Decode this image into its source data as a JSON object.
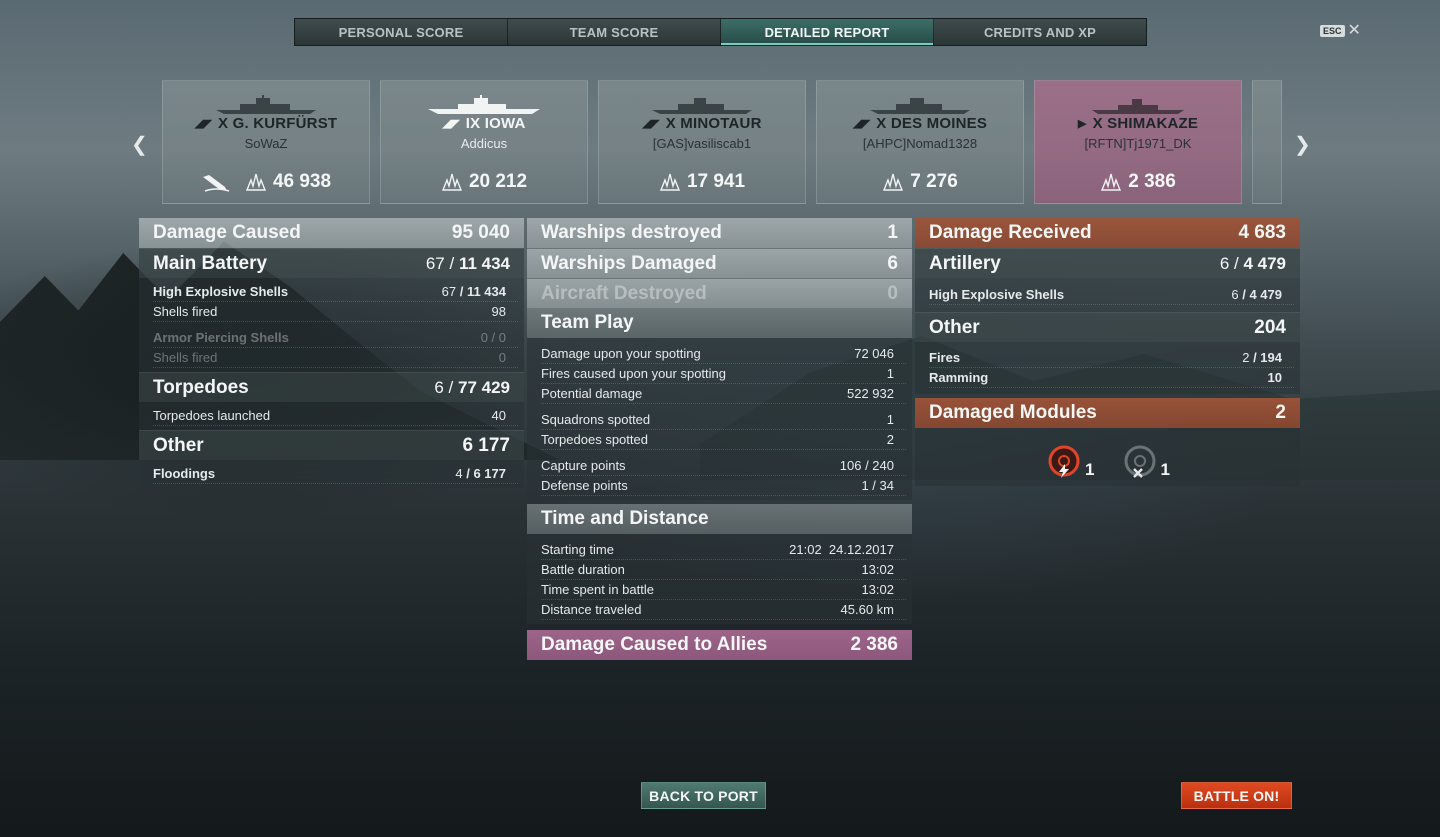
{
  "tabs": [
    "PERSONAL SCORE",
    "TEAM SCORE",
    "DETAILED REPORT",
    "CREDITS AND XP"
  ],
  "esc": {
    "key": "ESC",
    "close": "✕"
  },
  "nav": {
    "prev": "❮",
    "next": "❯"
  },
  "ships": [
    {
      "tier_name": "X G. KURFÜRST",
      "player": "SoWaZ",
      "damage": "46 938",
      "class_glyph": "◢◤",
      "sunk": true
    },
    {
      "tier_name": "IX IOWA",
      "player": "Addicus",
      "damage": "20 212",
      "class_glyph": "◢◤",
      "light": true
    },
    {
      "tier_name": "X MINOTAUR",
      "player": "[GAS]vasiliscab1",
      "damage": "17 941",
      "class_glyph": "◢◤"
    },
    {
      "tier_name": "X DES MOINES",
      "player": "[AHPC]Nomad1328",
      "damage": "7 276",
      "class_glyph": "◢◤"
    },
    {
      "tier_name": "X SHIMAKAZE",
      "player": "[RFTN]Tj1971_DK",
      "damage": "2 386",
      "class_glyph": "▶"
    }
  ],
  "damage_caused": {
    "title": "Damage Caused",
    "total": "95 040",
    "main_battery": {
      "title": "Main Battery",
      "hits": "67",
      "dmg": "11 434"
    },
    "he": {
      "label": "High Explosive Shells",
      "hits": "67",
      "dmg": "11 434"
    },
    "he_fired": {
      "label": "Shells fired",
      "value": "98"
    },
    "ap": {
      "label": "Armor Piercing Shells",
      "value": "0 / 0"
    },
    "ap_fired": {
      "label": "Shells fired",
      "value": "0"
    },
    "torpedoes": {
      "title": "Torpedoes",
      "hits": "6",
      "dmg": "77 429"
    },
    "torp_launched": {
      "label": "Torpedoes launched",
      "value": "40"
    },
    "other": {
      "title": "Other",
      "value": "6 177"
    },
    "floodings": {
      "label": "Floodings",
      "hits": "4",
      "dmg": "6 177"
    }
  },
  "middle": {
    "destroyed": {
      "label": "Warships destroyed",
      "value": "1"
    },
    "damaged": {
      "label": "Warships Damaged",
      "value": "6"
    },
    "aircraft": {
      "label": "Aircraft Destroyed",
      "value": "0"
    },
    "team_play": {
      "title": "Team Play",
      "rows": [
        {
          "label": "Damage upon your spotting",
          "value": "72 046"
        },
        {
          "label": "Fires caused upon your spotting",
          "value": "1"
        },
        {
          "label": "Potential damage",
          "value": "522 932"
        },
        {
          "label": "Squadrons spotted",
          "value": "1"
        },
        {
          "label": "Torpedoes spotted",
          "value": "2"
        },
        {
          "label": "Capture points",
          "value": "106 / 240"
        },
        {
          "label": "Defense points",
          "value": "1 / 34"
        }
      ]
    },
    "time": {
      "title": "Time and Distance",
      "rows": [
        {
          "label": "Starting time",
          "value": "21:02  24.12.2017"
        },
        {
          "label": "Battle duration",
          "value": "13:02"
        },
        {
          "label": "Time spent in battle",
          "value": "13:02"
        },
        {
          "label": "Distance traveled",
          "value": "45.60 km"
        }
      ]
    },
    "allies": {
      "label": "Damage Caused to Allies",
      "value": "2 386"
    }
  },
  "received": {
    "title": "Damage Received",
    "total": "4 683",
    "artillery": {
      "title": "Artillery",
      "hits": "6",
      "dmg": "4 479"
    },
    "he": {
      "label": "High Explosive Shells",
      "hits": "6",
      "dmg": "4 479"
    },
    "other": {
      "title": "Other",
      "value": "204"
    },
    "fires": {
      "label": "Fires",
      "hits": "2",
      "dmg": "194"
    },
    "ramming": {
      "label": "Ramming",
      "value": "10"
    },
    "modules": {
      "title": "Damaged Modules",
      "value": "2",
      "items": [
        {
          "icon": "engine-damage-icon",
          "count": "1"
        },
        {
          "icon": "steering-destroyed-icon",
          "count": "1"
        }
      ]
    }
  },
  "buttons": {
    "back": "BACK TO PORT",
    "battle": "BATTLE ON!"
  },
  "colors": {
    "accent_tab": "#3d6e68",
    "received_header": "#a05438",
    "allies_header": "#a86a92",
    "battle_button": "#e04a22"
  }
}
